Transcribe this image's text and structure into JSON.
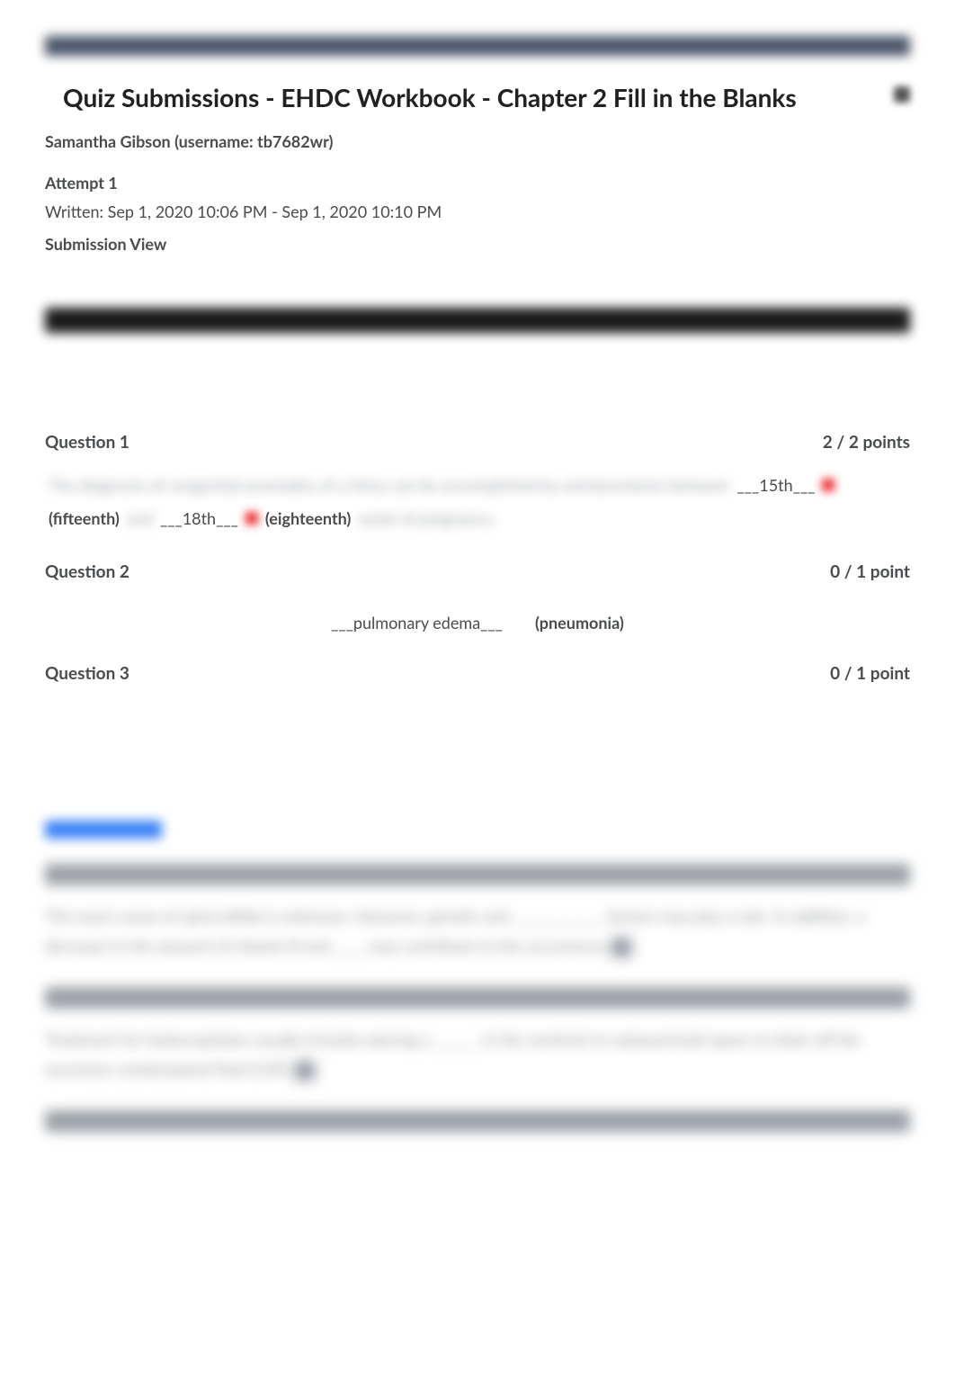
{
  "header": {
    "title": "Quiz Submissions - EHDC Workbook - Chapter 2 Fill in the Blanks",
    "user_line": "Samantha Gibson (username: tb7682wr)",
    "attempt_label": "Attempt 1",
    "written_line": "Written: Sep 1, 2020 10:06 PM - Sep 1, 2020 10:10 PM",
    "subview_label": "Submission View"
  },
  "questions": [
    {
      "title": "Question 1",
      "points": "2 / 2 points",
      "blur_lead": "The diagnosis of congenital anomalies of a fetus can be accomplished by amniocentesis between",
      "answers": [
        {
          "given": "___15th___",
          "correct": "(fifteenth)"
        },
        {
          "given": "___18th___",
          "correct": "(eighteenth)"
        }
      ],
      "blur_mid": "and",
      "blur_trail": "week of pregnancy."
    },
    {
      "title": "Question 2",
      "points": "0 / 1 point",
      "answers": [
        {
          "given": "___pulmonary edema___",
          "correct": "(pneumonia)"
        }
      ]
    },
    {
      "title": "Question 3",
      "points": "0 / 1 point"
    }
  ],
  "blurred_paragraphs": {
    "p1": "The exact cause of spina bifida is unknown. However, genetic and ____________ factors may play a role. In addition, a decrease in the amount of vitamin B and ____ may contribute to the occurrence.",
    "p2": "Treatment for hydrocephalus usually includes placing a ______ in the ventricle to subarachnoid space to drain off the excessive cerebrospinal fluid (CSF)."
  },
  "icons": {
    "gear": "gear-icon"
  }
}
